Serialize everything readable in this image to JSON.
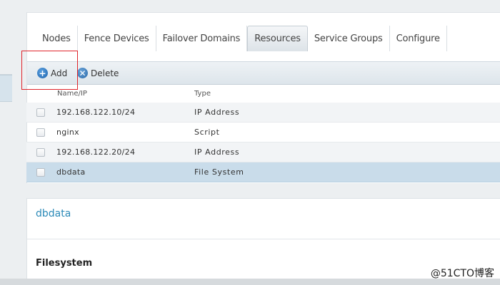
{
  "tabs": [
    {
      "label": "Nodes"
    },
    {
      "label": "Fence Devices"
    },
    {
      "label": "Failover Domains"
    },
    {
      "label": "Resources"
    },
    {
      "label": "Service Groups"
    },
    {
      "label": "Configure"
    }
  ],
  "active_tab": "Resources",
  "toolbar": {
    "add_label": "Add",
    "add_icon": "plus-circle-icon",
    "delete_label": "Delete",
    "delete_icon": "x-circle-icon"
  },
  "table": {
    "columns": [
      "Name/IP",
      "Type"
    ],
    "rows": [
      {
        "name": "192.168.122.10/24",
        "type": "IP Address",
        "selected": false
      },
      {
        "name": "nginx",
        "type": "Script",
        "selected": false
      },
      {
        "name": "192.168.122.20/24",
        "type": "IP Address",
        "selected": false
      },
      {
        "name": "dbdata",
        "type": "File System",
        "selected": true
      }
    ]
  },
  "detail": {
    "title": "dbdata",
    "section_title": "Filesystem"
  },
  "watermark": "@51CTO博客",
  "colors": {
    "accent": "#2c8ab8",
    "selected_row": "#c9dcea",
    "annotation_box": "#e0242b"
  }
}
